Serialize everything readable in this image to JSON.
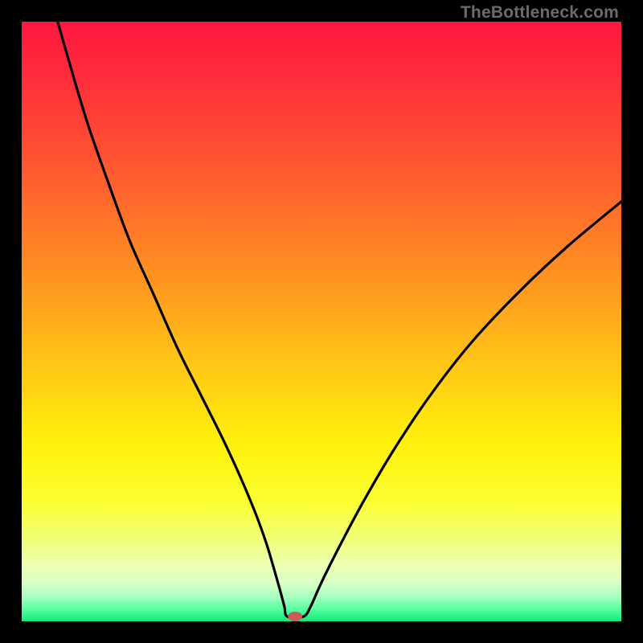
{
  "watermark": "TheBottleneck.com",
  "colors": {
    "frame": "#000000",
    "curve": "#000000",
    "marker": "#cc5a58",
    "gradient_stops": [
      {
        "offset": 0.0,
        "color": "#ff173f"
      },
      {
        "offset": 0.1,
        "color": "#ff2f3b"
      },
      {
        "offset": 0.25,
        "color": "#ff5a30"
      },
      {
        "offset": 0.4,
        "color": "#ff8a23"
      },
      {
        "offset": 0.55,
        "color": "#ffbf18"
      },
      {
        "offset": 0.7,
        "color": "#fff00a"
      },
      {
        "offset": 0.8,
        "color": "#fbff30"
      },
      {
        "offset": 0.86,
        "color": "#f0ff73"
      },
      {
        "offset": 0.905,
        "color": "#ecffb0"
      },
      {
        "offset": 0.935,
        "color": "#d9ffc8"
      },
      {
        "offset": 0.96,
        "color": "#a6ffbf"
      },
      {
        "offset": 0.98,
        "color": "#54ff9e"
      },
      {
        "offset": 1.0,
        "color": "#12e77e"
      }
    ]
  },
  "chart_data": {
    "type": "line",
    "title": "",
    "xlabel": "",
    "ylabel": "",
    "xlim": [
      0,
      100
    ],
    "ylim": [
      0,
      100
    ],
    "series": [
      {
        "name": "curve",
        "smooth": true,
        "x": [
          6.0,
          8.0,
          11.0,
          14.5,
          18.0,
          22.0,
          26.0,
          30.0,
          33.5,
          36.5,
          39.0,
          40.8,
          42.0,
          43.0,
          43.8,
          44.3,
          47.0,
          48.2,
          50.0,
          53.0,
          57.0,
          62.0,
          68.0,
          75.0,
          83.0,
          91.0,
          100.0
        ],
        "y": [
          100.0,
          93.0,
          83.0,
          73.0,
          63.5,
          54.5,
          45.5,
          37.5,
          30.5,
          24.0,
          18.0,
          13.0,
          9.0,
          5.5,
          2.5,
          0.8,
          0.8,
          2.5,
          6.5,
          12.5,
          20.0,
          28.5,
          37.5,
          46.5,
          55.0,
          62.5,
          70.0
        ]
      }
    ],
    "flat_segment": {
      "x0": 44.3,
      "x1": 47.0,
      "y": 0.8
    },
    "marker": {
      "x": 45.6,
      "y": 0.8,
      "rx": 1.2,
      "ry": 0.8
    }
  }
}
